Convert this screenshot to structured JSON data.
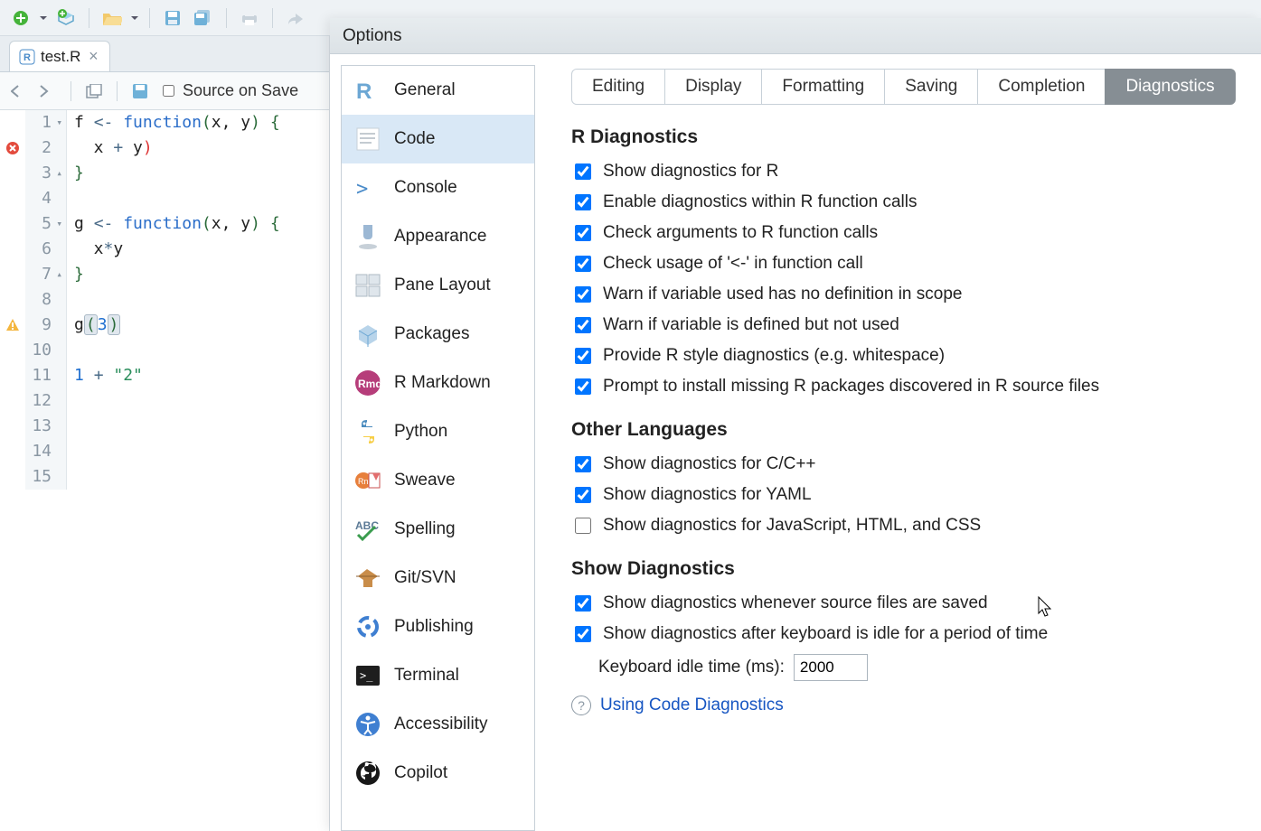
{
  "editor": {
    "tab_name": "test.R",
    "source_on_save_label": "Source on Save",
    "lines": [
      {
        "num": 1,
        "fold": "down",
        "marker": "",
        "tokens": [
          [
            "id",
            "f "
          ],
          [
            "op",
            "<-"
          ],
          [
            "id",
            " "
          ],
          [
            "kw",
            "function"
          ],
          [
            "paren",
            "("
          ],
          [
            "id",
            "x"
          ],
          [
            "id",
            ", "
          ],
          [
            "id",
            "y"
          ],
          [
            "paren",
            ")"
          ],
          [
            "id",
            " "
          ],
          [
            "brace",
            "{"
          ]
        ]
      },
      {
        "num": 2,
        "fold": "",
        "marker": "error",
        "tokens": [
          [
            "id",
            "  x "
          ],
          [
            "op",
            "+"
          ],
          [
            "id",
            " y"
          ],
          [
            "err-paren",
            ")"
          ]
        ]
      },
      {
        "num": 3,
        "fold": "up",
        "marker": "",
        "tokens": [
          [
            "brace",
            "}"
          ]
        ]
      },
      {
        "num": 4,
        "fold": "",
        "marker": "",
        "tokens": []
      },
      {
        "num": 5,
        "fold": "down",
        "marker": "",
        "tokens": [
          [
            "id",
            "g "
          ],
          [
            "op",
            "<-"
          ],
          [
            "id",
            " "
          ],
          [
            "kw",
            "function"
          ],
          [
            "paren",
            "("
          ],
          [
            "id",
            "x"
          ],
          [
            "id",
            ", "
          ],
          [
            "id",
            "y"
          ],
          [
            "paren",
            ")"
          ],
          [
            "id",
            " "
          ],
          [
            "brace",
            "{"
          ]
        ]
      },
      {
        "num": 6,
        "fold": "",
        "marker": "",
        "tokens": [
          [
            "id",
            "  x"
          ],
          [
            "op",
            "*"
          ],
          [
            "id",
            "y"
          ]
        ]
      },
      {
        "num": 7,
        "fold": "up",
        "marker": "",
        "tokens": [
          [
            "brace",
            "}"
          ]
        ]
      },
      {
        "num": 8,
        "fold": "",
        "marker": "",
        "tokens": []
      },
      {
        "num": 9,
        "fold": "",
        "marker": "warn",
        "tokens": [
          [
            "id",
            "g"
          ],
          [
            "hl-paren",
            "("
          ],
          [
            "num",
            "3"
          ],
          [
            "hl-paren",
            ")"
          ]
        ]
      },
      {
        "num": 10,
        "fold": "",
        "marker": "",
        "tokens": []
      },
      {
        "num": 11,
        "fold": "",
        "marker": "",
        "tokens": [
          [
            "num",
            "1"
          ],
          [
            "id",
            " "
          ],
          [
            "op",
            "+"
          ],
          [
            "id",
            " "
          ],
          [
            "str",
            "\"2\""
          ]
        ]
      },
      {
        "num": 12,
        "fold": "",
        "marker": "",
        "tokens": []
      },
      {
        "num": 13,
        "fold": "",
        "marker": "",
        "tokens": []
      },
      {
        "num": 14,
        "fold": "",
        "marker": "",
        "tokens": []
      },
      {
        "num": 15,
        "fold": "",
        "marker": "",
        "tokens": []
      }
    ]
  },
  "options": {
    "title": "Options",
    "sidebar": [
      {
        "id": "general",
        "label": "General"
      },
      {
        "id": "code",
        "label": "Code",
        "selected": true
      },
      {
        "id": "console",
        "label": "Console"
      },
      {
        "id": "appearance",
        "label": "Appearance"
      },
      {
        "id": "pane-layout",
        "label": "Pane Layout"
      },
      {
        "id": "packages",
        "label": "Packages"
      },
      {
        "id": "rmarkdown",
        "label": "R Markdown"
      },
      {
        "id": "python",
        "label": "Python"
      },
      {
        "id": "sweave",
        "label": "Sweave"
      },
      {
        "id": "spelling",
        "label": "Spelling"
      },
      {
        "id": "git-svn",
        "label": "Git/SVN"
      },
      {
        "id": "publishing",
        "label": "Publishing"
      },
      {
        "id": "terminal",
        "label": "Terminal"
      },
      {
        "id": "accessibility",
        "label": "Accessibility"
      },
      {
        "id": "copilot",
        "label": "Copilot"
      }
    ],
    "tabs": [
      {
        "id": "editing",
        "label": "Editing"
      },
      {
        "id": "display",
        "label": "Display"
      },
      {
        "id": "formatting",
        "label": "Formatting"
      },
      {
        "id": "saving",
        "label": "Saving"
      },
      {
        "id": "completion",
        "label": "Completion"
      },
      {
        "id": "diagnostics",
        "label": "Diagnostics",
        "active": true
      }
    ],
    "sections": {
      "r_diag_head": "R Diagnostics",
      "other_lang_head": "Other Languages",
      "show_diag_head": "Show Diagnostics",
      "idle_label": "Keyboard idle time (ms):",
      "idle_value": "2000",
      "help_link": "Using Code Diagnostics",
      "r_diag": [
        {
          "id": "show-r",
          "label": "Show diagnostics for R",
          "checked": true
        },
        {
          "id": "enable-in-calls",
          "label": "Enable diagnostics within R function calls",
          "checked": true
        },
        {
          "id": "check-args",
          "label": "Check arguments to R function calls",
          "checked": true
        },
        {
          "id": "check-assign",
          "label": "Check usage of '<-' in function call",
          "checked": true
        },
        {
          "id": "warn-undef",
          "label": "Warn if variable used has no definition in scope",
          "checked": true
        },
        {
          "id": "warn-unused",
          "label": "Warn if variable is defined but not used",
          "checked": true
        },
        {
          "id": "style",
          "label": "Provide R style diagnostics (e.g. whitespace)",
          "checked": true
        },
        {
          "id": "install-missing",
          "label": "Prompt to install missing R packages discovered in R source files",
          "checked": true
        }
      ],
      "other_lang": [
        {
          "id": "cpp",
          "label": "Show diagnostics for C/C++",
          "checked": true
        },
        {
          "id": "yaml",
          "label": "Show diagnostics for YAML",
          "checked": true
        },
        {
          "id": "web",
          "label": "Show diagnostics for JavaScript, HTML, and CSS",
          "checked": false
        }
      ],
      "show_diag": [
        {
          "id": "on-save",
          "label": "Show diagnostics whenever source files are saved",
          "checked": true
        },
        {
          "id": "on-idle",
          "label": "Show diagnostics after keyboard is idle for a period of time",
          "checked": true
        }
      ]
    }
  }
}
